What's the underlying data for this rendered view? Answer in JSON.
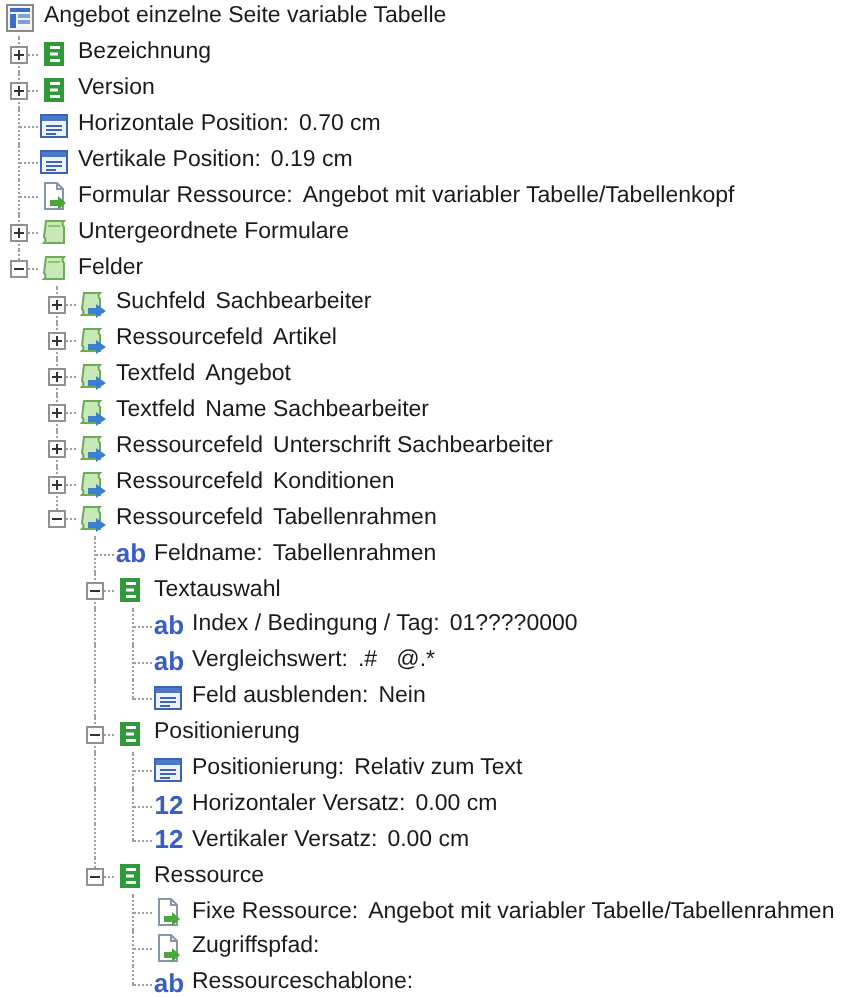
{
  "tree": {
    "kind": "form",
    "label": "Angebot einzelne Seite variable Tabelle",
    "children": [
      {
        "kind": "section",
        "label": "Bezeichnung",
        "expanded": false
      },
      {
        "kind": "section",
        "label": "Version",
        "expanded": false
      },
      {
        "kind": "property",
        "label": "Horizontale Position:",
        "value": "0.70 cm"
      },
      {
        "kind": "property",
        "label": "Vertikale Position:",
        "value": "0.19 cm"
      },
      {
        "kind": "resource",
        "label": "Formular Ressource:",
        "value": "Angebot mit variabler Tabelle/Tabellenkopf"
      },
      {
        "kind": "folder",
        "label": "Untergeordnete Formulare",
        "expanded": false
      },
      {
        "kind": "folder",
        "label": "Felder",
        "expanded": true,
        "children": [
          {
            "kind": "field",
            "label": "Suchfeld",
            "value": "Sachbearbeiter",
            "expanded": false
          },
          {
            "kind": "field",
            "label": "Ressourcefeld",
            "value": "Artikel",
            "expanded": false
          },
          {
            "kind": "field",
            "label": "Textfeld",
            "value": "Angebot",
            "expanded": false
          },
          {
            "kind": "field",
            "label": "Textfeld",
            "value": "Name Sachbearbeiter",
            "expanded": false
          },
          {
            "kind": "field",
            "label": "Ressourcefeld",
            "value": "Unterschrift Sachbearbeiter",
            "expanded": false
          },
          {
            "kind": "field",
            "label": "Ressourcefeld",
            "value": "Konditionen",
            "expanded": false
          },
          {
            "kind": "field",
            "label": "Ressourcefeld",
            "value": "Tabellenrahmen",
            "expanded": true,
            "children": [
              {
                "kind": "badge",
                "badge": "ab",
                "label": "Feldname:",
                "value": "Tabellenrahmen"
              },
              {
                "kind": "section",
                "label": "Textauswahl",
                "expanded": true,
                "children": [
                  {
                    "kind": "badge",
                    "badge": "ab",
                    "label": "Index / Bedingung / Tag:",
                    "value": "01????0000"
                  },
                  {
                    "kind": "badge",
                    "badge": "ab",
                    "label": "Vergleichswert:",
                    "value": ".#   @.*"
                  },
                  {
                    "kind": "property",
                    "label": "Feld ausblenden:",
                    "value": "Nein"
                  }
                ]
              },
              {
                "kind": "section",
                "label": "Positionierung",
                "expanded": true,
                "children": [
                  {
                    "kind": "property",
                    "label": "Positionierung:",
                    "value": "Relativ zum Text"
                  },
                  {
                    "kind": "badge",
                    "badge": "12",
                    "label": "Horizontaler Versatz:",
                    "value": "0.00 cm"
                  },
                  {
                    "kind": "badge",
                    "badge": "12",
                    "label": "Vertikaler Versatz:",
                    "value": "0.00 cm"
                  }
                ]
              },
              {
                "kind": "section",
                "label": "Ressource",
                "expanded": true,
                "children": [
                  {
                    "kind": "resource",
                    "label": "Fixe Ressource:",
                    "value": "Angebot mit variabler Tabelle/Tabellenrahmen"
                  },
                  {
                    "kind": "resource",
                    "label": "Zugriffspfad:"
                  },
                  {
                    "kind": "badge",
                    "badge": "ab",
                    "label": "Ressourceschablone:"
                  }
                ]
              }
            ]
          }
        ]
      }
    ]
  }
}
